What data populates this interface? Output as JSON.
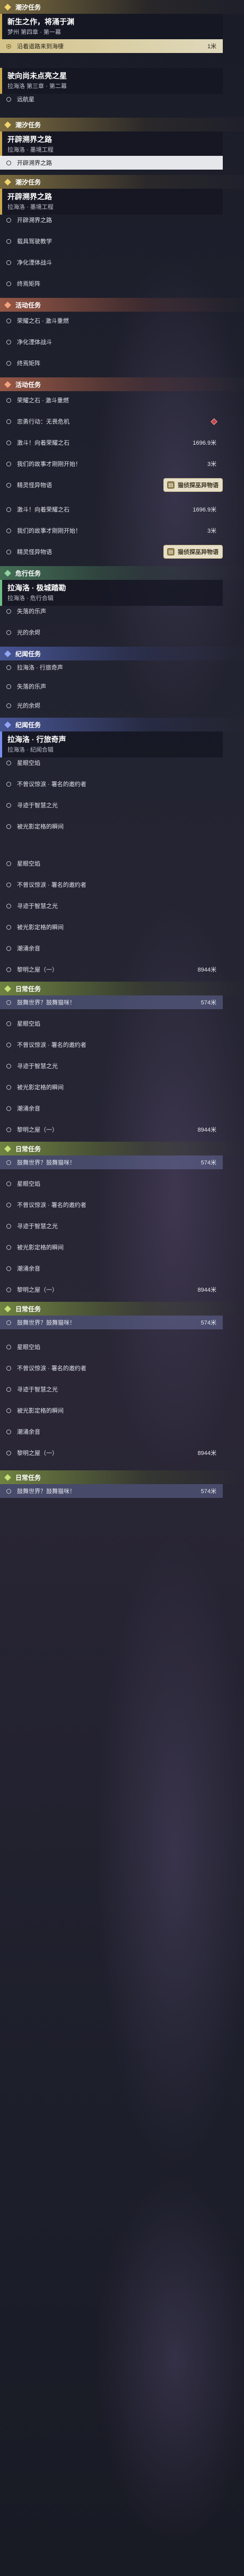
{
  "screens": [
    {
      "id": "s1",
      "sections": [
        {
          "header": "潮汐任务",
          "style": "main",
          "title": "新生之作，将涌于渊",
          "subtitle": "梦州 第四章 · 第一幕",
          "rows": [
            {
              "text": "沿着道路来到海棲",
              "dist": "1米",
              "state": "track"
            }
          ]
        },
        {
          "header": "",
          "style": "main",
          "title": "驶向尚未点亮之星",
          "subtitle": "拉海洛 第三章 · 第二幕",
          "rows": [
            {
              "text": "远航星",
              "dist": "",
              "state": ""
            }
          ]
        }
      ]
    }
  ],
  "panels": [
    {
      "header": "潮汐任务",
      "hstyle": "main",
      "title": "新生之作，将涌于渊",
      "subtitle": "梦州 第四章 · 第一幕",
      "tstyle": "",
      "rows": [
        {
          "text": "沿着道路来到海棲",
          "dist": "1米",
          "state": "track"
        }
      ]
    },
    {
      "header": "",
      "hstyle": "",
      "title": "驶向尚未点亮之星",
      "subtitle": "拉海洛 第三章 · 第二幕",
      "tstyle": "",
      "rows": [
        {
          "text": "远航星"
        }
      ]
    },
    {
      "header": "潮汐任务",
      "hstyle": "main",
      "title": "开辟溯界之路",
      "subtitle": "拉海洛 · 墨境工程",
      "tstyle": "",
      "rows": [
        {
          "text": "开辟溯界之路",
          "state": "sel"
        }
      ]
    },
    {
      "header": "潮汐任务",
      "hstyle": "main",
      "title": "开辟溯界之路",
      "subtitle": "拉海洛 · 墨境工程",
      "tstyle": "",
      "rows": [
        {
          "text": "开辟溯界之路"
        },
        {
          "text": "载具驾驶教学"
        },
        {
          "text": "净化湮体战斗"
        },
        {
          "text": "终焉矩阵"
        }
      ]
    },
    {
      "header": "活动任务",
      "hstyle": "act",
      "title": "",
      "subtitle": "",
      "tstyle": "",
      "rows": [
        {
          "text": "荣耀之石 · 激斗重燃"
        },
        {
          "text": "净化湮体战斗"
        },
        {
          "text": "终焉矩阵"
        }
      ]
    },
    {
      "header": "活动任务",
      "hstyle": "act",
      "title": "",
      "subtitle": "",
      "tstyle": "",
      "rows": [
        {
          "text": "荣耀之石 · 激斗重燃"
        },
        {
          "text": "忠勇行动：无畏危机",
          "mark": true
        },
        {
          "text": "激斗！向着荣耀之石",
          "dist": "1696.9米"
        },
        {
          "text": "我们的故事才刚刚开始！",
          "dist": "3米"
        },
        {
          "text": "精灵怪异物语",
          "btn": "猫侦探巫异物语"
        }
      ]
    },
    {
      "header": "",
      "hstyle": "",
      "title": "",
      "subtitle": "",
      "tstyle": "",
      "rows": [
        {
          "text": "激斗！向着荣耀之石",
          "dist": "1696.9米"
        },
        {
          "text": "我们的故事才刚刚开始！",
          "dist": "3米"
        },
        {
          "text": "精灵怪异物语",
          "btn": "猫侦探巫异物语"
        }
      ]
    },
    {
      "header": "危行任务",
      "hstyle": "side",
      "title": "拉海洛 · 极城踏勘",
      "subtitle": "拉海洛 · 危行合辑",
      "tstyle": "side",
      "rows": [
        {
          "text": "失落的乐声"
        },
        {
          "text": "光的余烬"
        }
      ]
    },
    {
      "header": "纪闻任务",
      "hstyle": "leg",
      "title": "",
      "subtitle": "",
      "tstyle": "",
      "rows": [
        {
          "text": "拉海洛 · 行旅奇声",
          "state": "heading"
        },
        {
          "text": "失落的乐声"
        },
        {
          "text": "光的余烬"
        }
      ]
    }
  ]
}
